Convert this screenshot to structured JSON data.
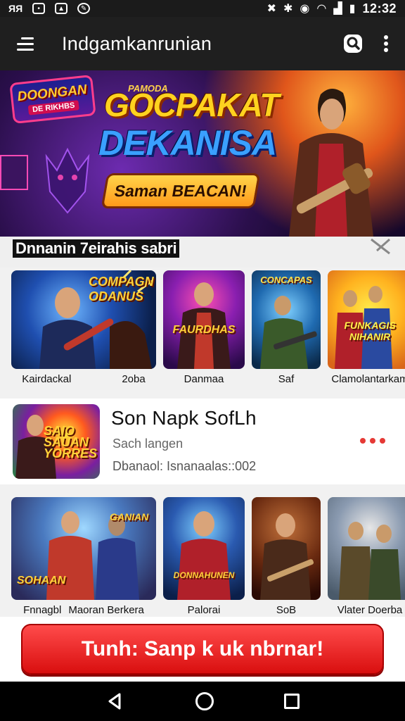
{
  "status_bar": {
    "time": "12:32",
    "left_icons": [
      "signal-label-icon",
      "battery-status-icon",
      "image-notification-icon",
      "chat-notification-icon"
    ],
    "right_icons": [
      "mute-icon",
      "bluetooth-icon",
      "location-icon",
      "wifi-icon",
      "cell-signal-icon",
      "battery-icon"
    ]
  },
  "app_bar": {
    "title": "Indgamkanrunian"
  },
  "hero": {
    "badge_line1": "DOONGAN",
    "badge_line2": "DE RIKHBS",
    "small_label": "PAMODA",
    "title_line1": "GOCPAKAT",
    "title_line2": "DEKANISA",
    "cta_label": "Saman BEACAN!"
  },
  "section": {
    "title": "Dnnanin 7eirahis sabri"
  },
  "row1": [
    {
      "label": "Kairdackal",
      "art": ""
    },
    {
      "label": "2oba",
      "art": "COMPAGN ODANUS"
    },
    {
      "label": "Danmaa",
      "art": "FAURDHAS"
    },
    {
      "label": "Saf",
      "art": "CONCAPAS"
    },
    {
      "label": "Clamolantarkam",
      "art": "FUNKAGIS NIHANIR"
    }
  ],
  "featured": {
    "title": "Son Napk SofLh",
    "subtitle": "Sach langen",
    "meta": "Dbanaol: Isnanaalas::002",
    "thumb_art": "SAIO SAUAN YORRES"
  },
  "row2": [
    {
      "label": "Fnnagbl",
      "art": "SOHAAN"
    },
    {
      "label": "Maoran Berkera",
      "art": "GANIAN"
    },
    {
      "label": "Palorai",
      "art": "DONNAHUNEN"
    },
    {
      "label": "SoB",
      "art": ""
    },
    {
      "label": "Vlater Doerba",
      "art": ""
    }
  ],
  "cta": {
    "label": "Tunh: Sanp k uk nbrnar!"
  },
  "colors": {
    "accent_red": "#e53935",
    "app_bar": "#1f1f1f",
    "hero_gold": "#ffd21f",
    "hero_blue": "#3aa0ff"
  }
}
